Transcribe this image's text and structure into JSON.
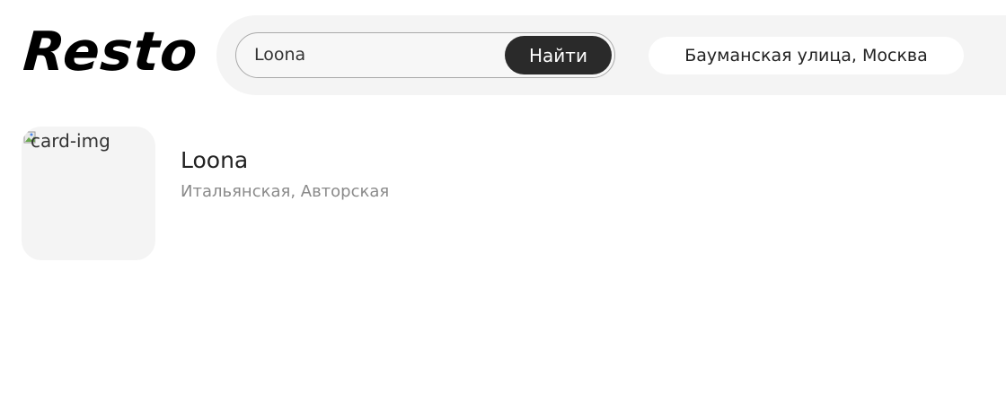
{
  "header": {
    "logo_text": "Resto",
    "search": {
      "value": "Loona",
      "button_label": "Найти"
    },
    "address": "Бауманская улица, Москва"
  },
  "results": [
    {
      "image_alt": "card-img",
      "title": "Loona",
      "cuisines": "Итальянская, Авторская"
    }
  ],
  "icons": {
    "broken_image": "broken-image-icon"
  }
}
